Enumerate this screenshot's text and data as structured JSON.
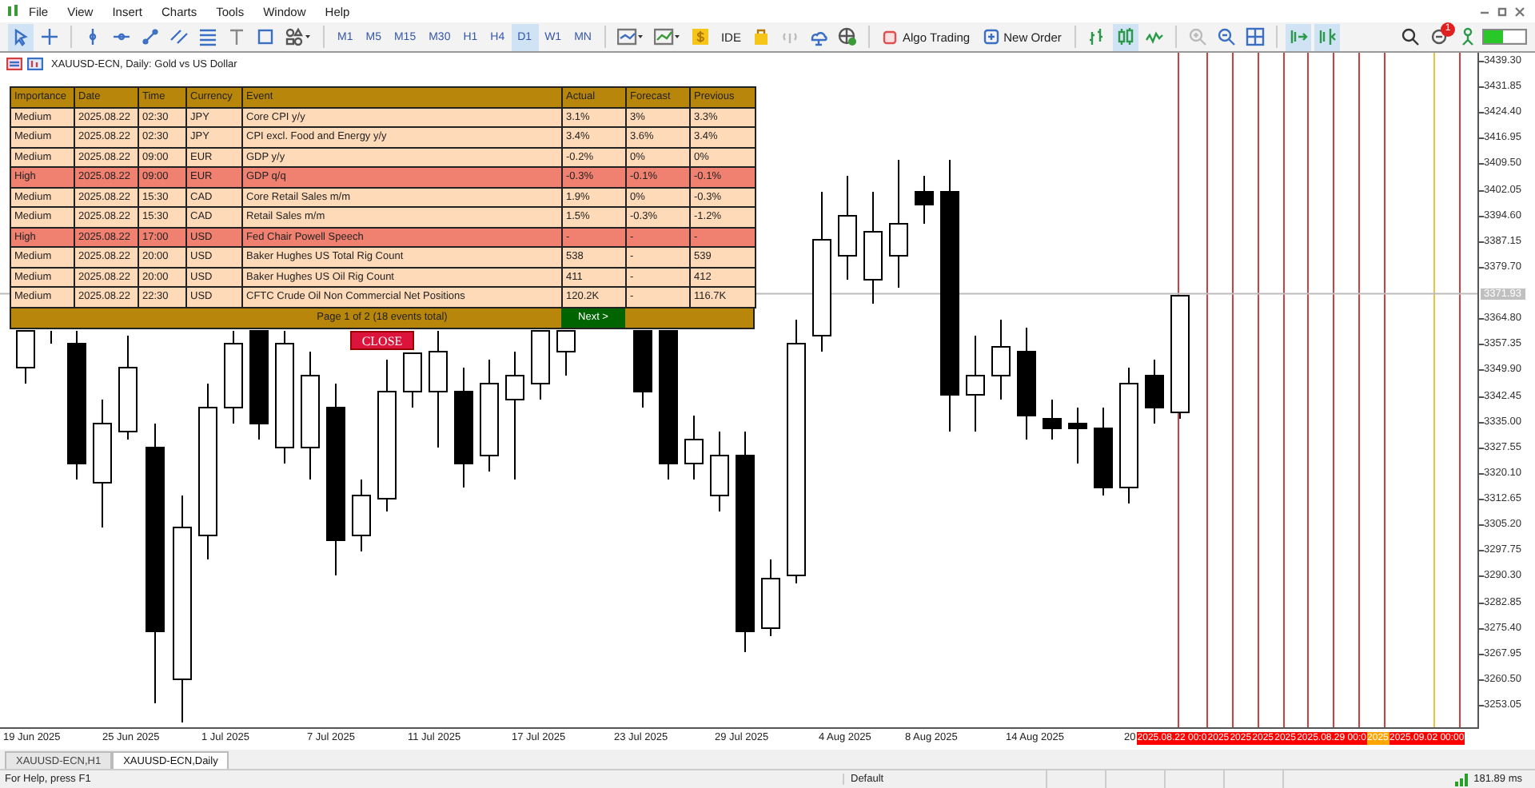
{
  "menu": [
    "File",
    "View",
    "Insert",
    "Charts",
    "Tools",
    "Window",
    "Help"
  ],
  "timeframes": [
    {
      "label": "M1",
      "selected": false
    },
    {
      "label": "M5",
      "selected": false
    },
    {
      "label": "M15",
      "selected": false
    },
    {
      "label": "M30",
      "selected": false
    },
    {
      "label": "H1",
      "selected": false
    },
    {
      "label": "H4",
      "selected": false
    },
    {
      "label": "D1",
      "selected": true
    },
    {
      "label": "W1",
      "selected": false
    },
    {
      "label": "MN",
      "selected": false
    }
  ],
  "ide_button": "IDE",
  "algo_trading_button": "Algo Trading",
  "new_order_button": "New Order",
  "notification_badge": "1",
  "chart": {
    "title": "XAUUSD-ECN, Daily:  Gold vs US Dollar",
    "price_labels": [
      "3439.30",
      "3431.85",
      "3424.40",
      "3416.95",
      "3409.50",
      "3402.05",
      "3394.60",
      "3387.15",
      "3379.70",
      "3364.80",
      "3357.35",
      "3349.90",
      "3342.45",
      "3335.00",
      "3327.55",
      "3320.10",
      "3312.65",
      "3305.20",
      "3297.75",
      "3290.30",
      "3282.85",
      "3275.40",
      "3267.95",
      "3260.50",
      "3253.05"
    ],
    "current_price": "3371.93",
    "time_labels": [
      "19 Jun 2025",
      "25 Jun 2025",
      "1 Jul 2025",
      "7 Jul 2025",
      "11 Jul 2025",
      "17 Jul 2025",
      "23 Jul 2025",
      "29 Jul 2025",
      "4 Aug 2025",
      "8 Aug 2025",
      "14 Aug 2025",
      "20"
    ],
    "event_markers": [
      {
        "label": "2025.08.22 00:0",
        "color": "#ff0000"
      },
      {
        "label": "2025",
        "color": "#ff0000"
      },
      {
        "label": "2025",
        "color": "#ff0000"
      },
      {
        "label": "2025",
        "color": "#ff0000"
      },
      {
        "label": "2025",
        "color": "#ff0000"
      },
      {
        "label": "2025.08.29 00:0",
        "color": "#ff0000"
      },
      {
        "label": "2025",
        "color": "#ffa500"
      },
      {
        "label": "2025.09.02 00:00",
        "color": "#ff0000"
      }
    ]
  },
  "calendar": {
    "columns": [
      "Importance",
      "Date",
      "Time",
      "Currency",
      "Event",
      "Actual",
      "Forecast",
      "Previous"
    ],
    "rows": [
      {
        "cells": [
          "Medium",
          "2025.08.22",
          "02:30",
          "JPY",
          "Core CPI y/y",
          "3.1%",
          "3%",
          "3.3%"
        ],
        "color": "#ffdab9"
      },
      {
        "cells": [
          "Medium",
          "2025.08.22",
          "02:30",
          "JPY",
          "CPI excl. Food and Energy y/y",
          "3.4%",
          "3.6%",
          "3.4%"
        ],
        "color": "#ffdab9"
      },
      {
        "cells": [
          "Medium",
          "2025.08.22",
          "09:00",
          "EUR",
          "GDP y/y",
          "-0.2%",
          "0%",
          "0%"
        ],
        "color": "#ffdab9"
      },
      {
        "cells": [
          "High",
          "2025.08.22",
          "09:00",
          "EUR",
          "GDP q/q",
          "-0.3%",
          "-0.1%",
          "-0.1%"
        ],
        "color": "#f08070"
      },
      {
        "cells": [
          "Medium",
          "2025.08.22",
          "15:30",
          "CAD",
          "Core Retail Sales m/m",
          "1.9%",
          "0%",
          "-0.3%"
        ],
        "color": "#ffdab9"
      },
      {
        "cells": [
          "Medium",
          "2025.08.22",
          "15:30",
          "CAD",
          "Retail Sales m/m",
          "1.5%",
          "-0.3%",
          "-1.2%"
        ],
        "color": "#ffdab9"
      },
      {
        "cells": [
          "High",
          "2025.08.22",
          "17:00",
          "USD",
          "Fed Chair Powell Speech",
          "-",
          "-",
          "-"
        ],
        "color": "#f08070"
      },
      {
        "cells": [
          "Medium",
          "2025.08.22",
          "20:00",
          "USD",
          "Baker Hughes US Total Rig Count",
          "538",
          "-",
          "539"
        ],
        "color": "#ffdab9"
      },
      {
        "cells": [
          "Medium",
          "2025.08.22",
          "20:00",
          "USD",
          "Baker Hughes US Oil Rig Count",
          "411",
          "-",
          "412"
        ],
        "color": "#ffdab9"
      },
      {
        "cells": [
          "Medium",
          "2025.08.22",
          "22:30",
          "USD",
          "CFTC Crude Oil Non Commercial Net Positions",
          "120.2K",
          "-",
          "116.7K"
        ],
        "color": "#ffdab9"
      }
    ],
    "footer": "Page 1 of 2 (18 events total)",
    "next_button": "Next >",
    "close_button": "CLOSE"
  },
  "tabs": [
    {
      "label": "XAUUSD-ECN,H1",
      "selected": false
    },
    {
      "label": "XAUUSD-ECN,Daily",
      "selected": true
    }
  ],
  "status_bar": {
    "help": "For Help, press F1",
    "profile": "Default",
    "ping": "181.89 ms"
  }
}
